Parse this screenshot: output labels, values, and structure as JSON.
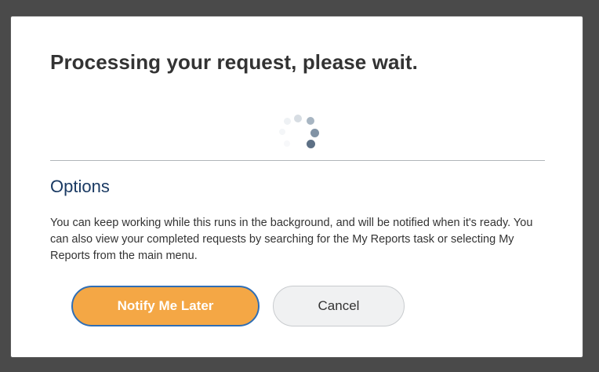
{
  "dialog": {
    "title": "Processing your request, please wait.",
    "spinner": {
      "icon": "loading-spinner-icon"
    },
    "options": {
      "heading": "Options",
      "description": "You can keep working while this runs in the background, and will be notified when it's ready. You can also view your completed requests by searching for the My Reports task or selecting My Reports from the main menu."
    },
    "buttons": {
      "notify_label": "Notify Me Later",
      "cancel_label": "Cancel"
    },
    "colors": {
      "primary_button": "#f4a745",
      "primary_border": "#2f6eb5",
      "heading": "#1a3a63"
    }
  }
}
